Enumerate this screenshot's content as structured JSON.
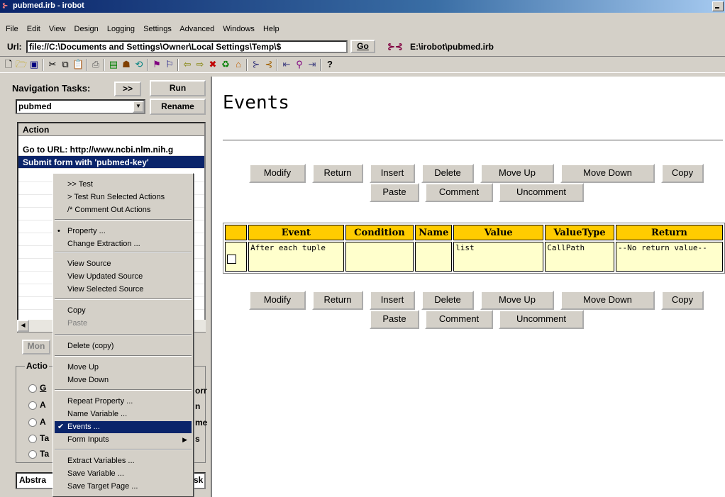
{
  "window": {
    "title": "pubmed.irb - irobot"
  },
  "menubar": [
    "File",
    "Edit",
    "View",
    "Design",
    "Logging",
    "Settings",
    "Advanced",
    "Windows",
    "Help"
  ],
  "urlbar": {
    "label": "Url:",
    "value": "file://C:\\Documents and Settings\\Owner\\Local Settings\\Temp\\$",
    "go": "Go",
    "path": "E:\\irobot\\pubmed.irb"
  },
  "nav": {
    "label": "Navigation Tasks:",
    "expand": ">>",
    "run": "Run",
    "task": "pubmed",
    "rename": "Rename"
  },
  "actions": {
    "header": "Action",
    "rows": [
      "Go to URL: http://www.ncbi.nlm.nih.g",
      "Submit form with 'pubmed-key'"
    ]
  },
  "left_lower": {
    "more_button": "Mon",
    "group_label": "Actio",
    "radios": [
      "G",
      "A",
      "A",
      "Ta",
      "Ta"
    ],
    "radio_right": [
      "orr",
      "n",
      "me",
      "s",
      ""
    ],
    "abstract": "Abstra",
    "abstract_right": "sk"
  },
  "context_menu": {
    "items": [
      {
        "label": ">> Test"
      },
      {
        "label": "> Test Run Selected Actions"
      },
      {
        "label": "/* Comment Out Actions"
      },
      {
        "label": "Property ...",
        "mark": "•"
      },
      {
        "label": "Change Extraction ..."
      },
      {
        "label": "View Source"
      },
      {
        "label": "View Updated Source"
      },
      {
        "label": "View Selected Source"
      },
      {
        "label": "Copy"
      },
      {
        "label": "Paste",
        "disabled": true
      },
      {
        "label": "Delete (copy)"
      },
      {
        "label": "Move Up"
      },
      {
        "label": "Move Down"
      },
      {
        "label": "Repeat Property ..."
      },
      {
        "label": "Name Variable ..."
      },
      {
        "label": "Events ...",
        "mark": "✔",
        "highlighted": true
      },
      {
        "label": "Form Inputs",
        "submenu": true
      },
      {
        "label": "Extract Variables ..."
      },
      {
        "label": "Save Variable ..."
      },
      {
        "label": "Save Target Page ..."
      }
    ]
  },
  "events_page": {
    "title": "Events",
    "buttons_row1": [
      "Modify",
      "Return",
      "Insert",
      "Delete",
      "Move Up",
      "Move Down",
      "Copy"
    ],
    "buttons_row2": [
      "Paste",
      "Comment",
      "Uncomment"
    ],
    "table": {
      "headers": [
        "",
        "Event",
        "Condition",
        "Name",
        "Value",
        "ValueType",
        "Return"
      ],
      "rows": [
        [
          "",
          "After each tuple",
          "",
          "",
          "list",
          "CallPath",
          "--No return value--"
        ]
      ]
    }
  }
}
